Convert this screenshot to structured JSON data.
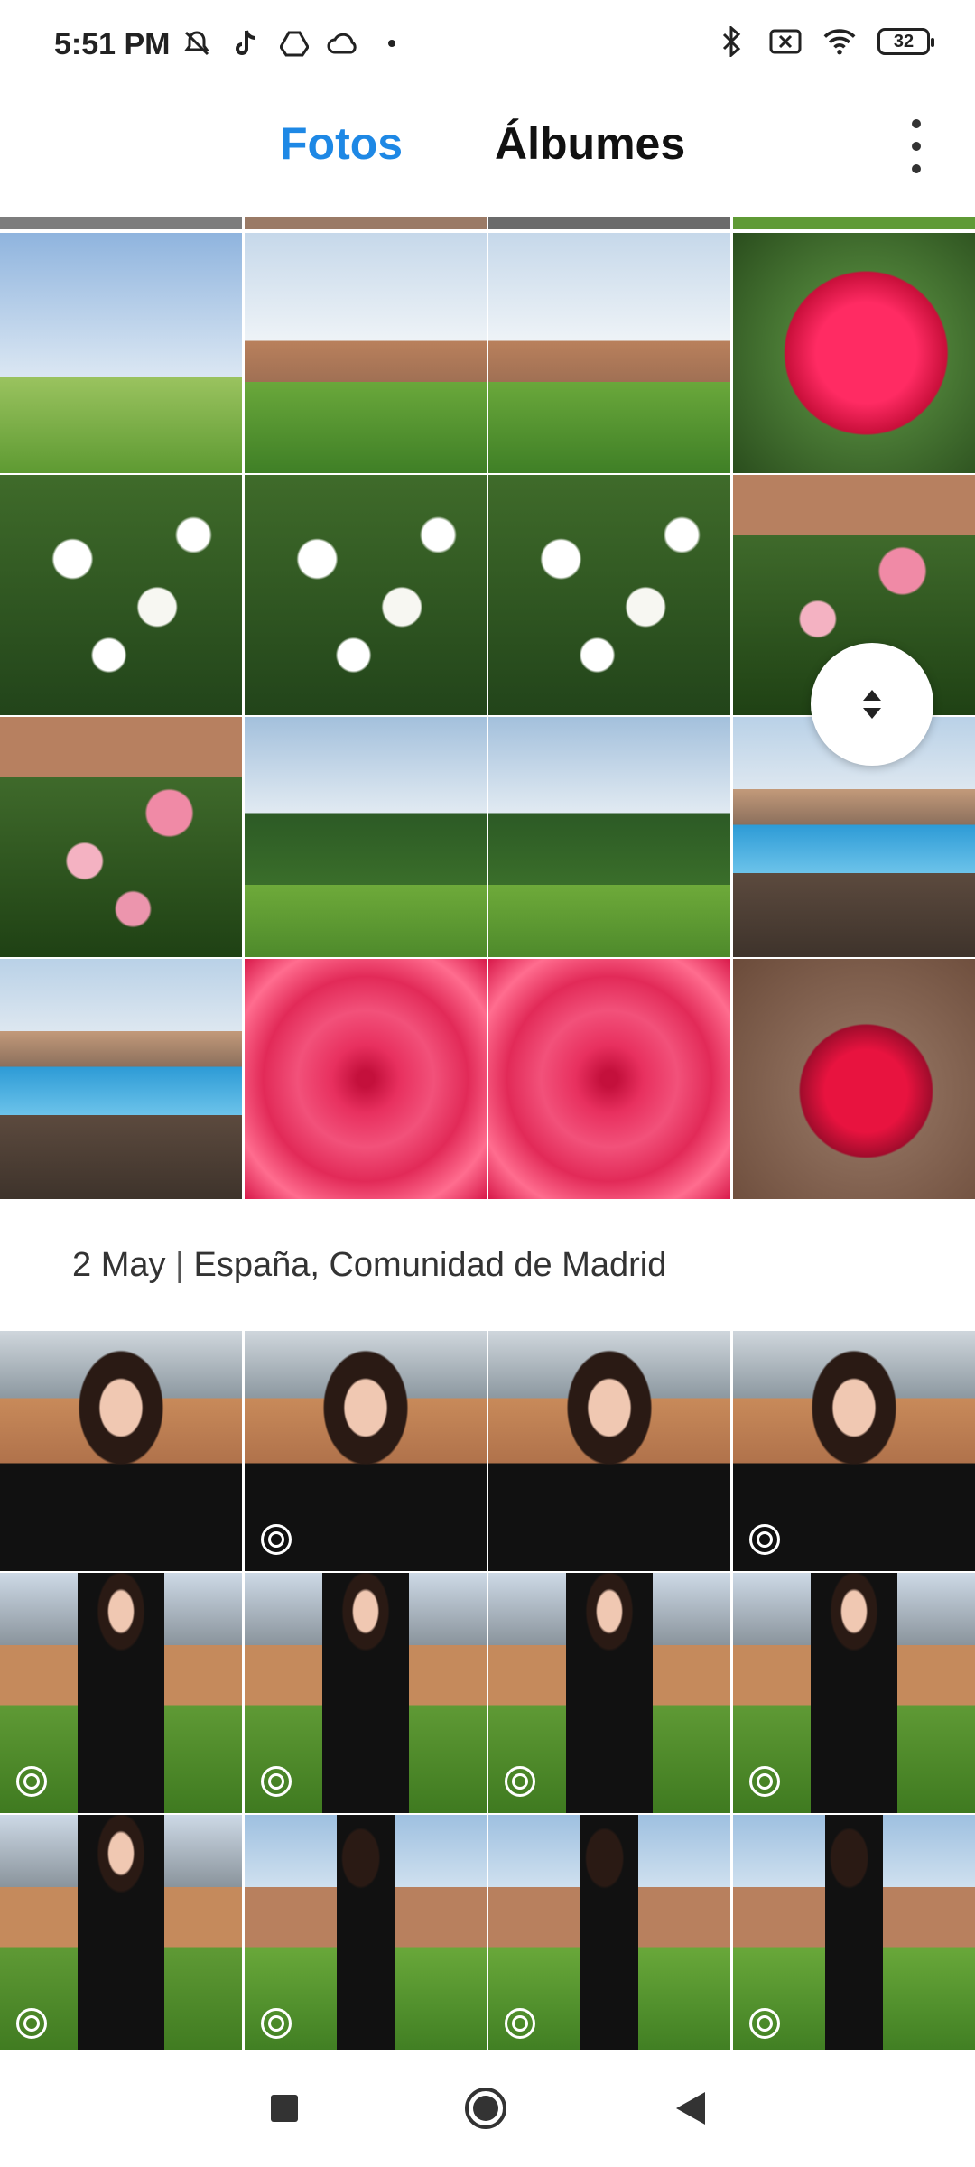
{
  "status_bar": {
    "time": "5:51 PM",
    "battery": "32",
    "left_icons": [
      "mute-icon",
      "tiktok-icon",
      "drive-icon",
      "cloud-icon",
      "dot-icon"
    ],
    "right_icons": [
      "bluetooth-icon",
      "no-sim-icon",
      "wifi-icon",
      "battery-icon"
    ]
  },
  "header": {
    "tabs": [
      {
        "label": "Fotos",
        "active": true,
        "color": "#1e88e5"
      },
      {
        "label": "Álbumes",
        "active": false
      }
    ],
    "more_icon": "more-vert-icon"
  },
  "sections": [
    {
      "date": "2 May",
      "location": "España, Comunidad de Madrid",
      "separator": "|"
    }
  ],
  "navbar": {
    "icons": [
      "recents-square-icon",
      "home-circle-icon",
      "back-triangle-icon"
    ]
  }
}
